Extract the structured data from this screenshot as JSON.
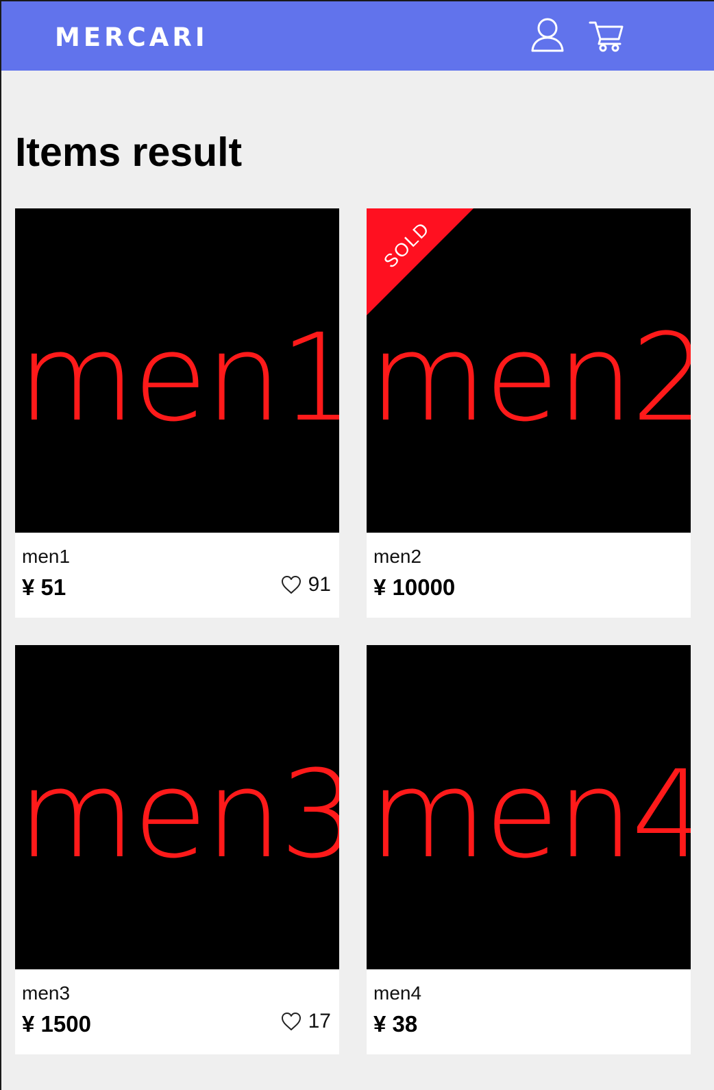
{
  "header": {
    "logo": "MERCARI",
    "user_icon": "user-icon",
    "cart_icon": "cart-icon",
    "background_color": "#6173ec"
  },
  "page": {
    "title": "Items result"
  },
  "items": [
    {
      "thumb_text": "men1",
      "name": "men1",
      "price": "¥ 51",
      "likes": "91",
      "sold": false
    },
    {
      "thumb_text": "men2",
      "name": "men2",
      "price": "¥ 10000",
      "likes": "",
      "sold": true,
      "sold_label": "SOLD"
    },
    {
      "thumb_text": "men3",
      "name": "men3",
      "price": "¥ 1500",
      "likes": "17",
      "sold": false
    },
    {
      "thumb_text": "men4",
      "name": "men4",
      "price": "¥ 38",
      "likes": "",
      "sold": false
    }
  ],
  "colors": {
    "thumb_background": "#000000",
    "thumb_text": "#ff1a1a",
    "sold_ribbon": "#ff1020",
    "page_background": "#efefef"
  }
}
